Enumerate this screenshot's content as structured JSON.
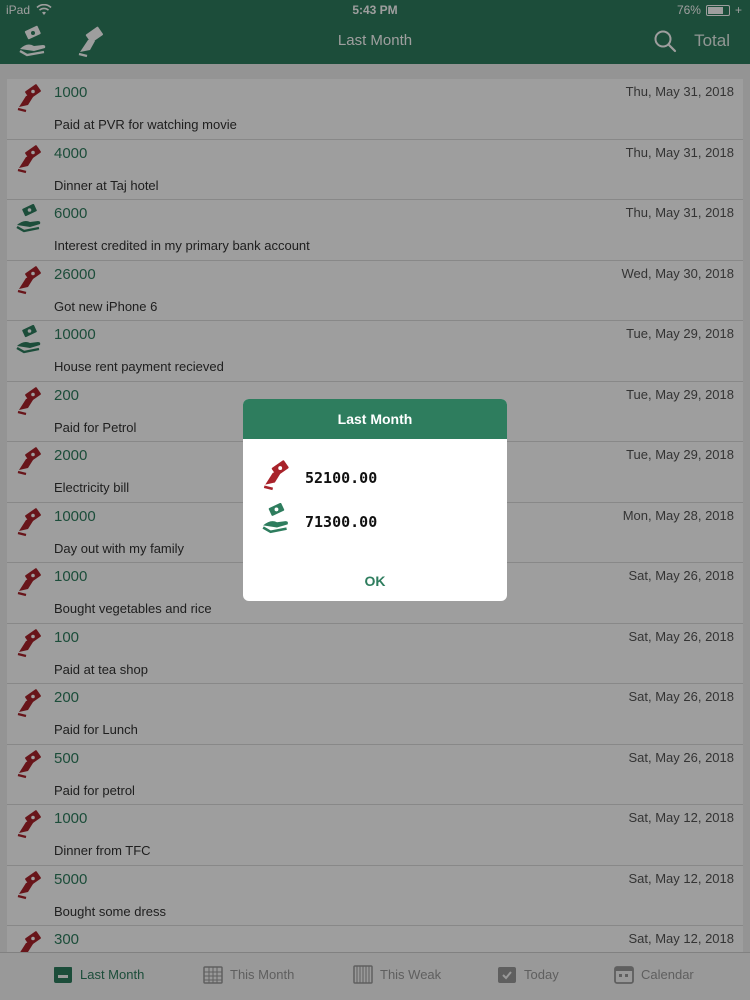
{
  "status": {
    "device": "iPad",
    "time": "5:43 PM",
    "battery_text": "76%",
    "battery_level": 0.76
  },
  "nav": {
    "title": "Last Month",
    "total_label": "Total"
  },
  "colors": {
    "brand": "#2e7d5e",
    "expense": "#a8222a",
    "income": "#2e7d5e"
  },
  "transactions": [
    {
      "type": "expense",
      "icon": "expense-hand-icon",
      "amount": "1000",
      "date": "Thu, May 31, 2018",
      "desc": "Paid at PVR for watching movie"
    },
    {
      "type": "expense",
      "icon": "expense-hand-icon",
      "amount": "4000",
      "date": "Thu, May 31, 2018",
      "desc": "Dinner at Taj hotel"
    },
    {
      "type": "income",
      "icon": "income-hand-icon",
      "amount": "6000",
      "date": "Thu, May 31, 2018",
      "desc": "Interest credited in my primary bank account"
    },
    {
      "type": "expense",
      "icon": "expense-hand-icon",
      "amount": "26000",
      "date": "Wed, May 30, 2018",
      "desc": "Got new iPhone 6"
    },
    {
      "type": "income",
      "icon": "income-hand-icon",
      "amount": "10000",
      "date": "Tue, May 29, 2018",
      "desc": "House rent payment recieved"
    },
    {
      "type": "expense",
      "icon": "expense-hand-icon",
      "amount": "200",
      "date": "Tue, May 29, 2018",
      "desc": "Paid for Petrol"
    },
    {
      "type": "expense",
      "icon": "expense-hand-icon",
      "amount": "2000",
      "date": "Tue, May 29, 2018",
      "desc": "Electricity bill"
    },
    {
      "type": "expense",
      "icon": "expense-hand-icon",
      "amount": "10000",
      "date": "Mon, May 28, 2018",
      "desc": "Day out with my family"
    },
    {
      "type": "expense",
      "icon": "expense-hand-icon",
      "amount": "1000",
      "date": "Sat, May 26, 2018",
      "desc": "Bought vegetables and rice"
    },
    {
      "type": "expense",
      "icon": "expense-hand-icon",
      "amount": "100",
      "date": "Sat, May 26, 2018",
      "desc": "Paid at tea shop"
    },
    {
      "type": "expense",
      "icon": "expense-hand-icon",
      "amount": "200",
      "date": "Sat, May 26, 2018",
      "desc": "Paid for Lunch"
    },
    {
      "type": "expense",
      "icon": "expense-hand-icon",
      "amount": "500",
      "date": "Sat, May 26, 2018",
      "desc": "Paid for petrol"
    },
    {
      "type": "expense",
      "icon": "expense-hand-icon",
      "amount": "1000",
      "date": "Sat, May 12, 2018",
      "desc": "Dinner from TFC"
    },
    {
      "type": "expense",
      "icon": "expense-hand-icon",
      "amount": "5000",
      "date": "Sat, May 12, 2018",
      "desc": "Bought some dress"
    },
    {
      "type": "expense",
      "icon": "expense-hand-icon",
      "amount": "300",
      "date": "Sat, May 12, 2018",
      "desc": ""
    }
  ],
  "tabs": [
    {
      "label": "Last Month",
      "icon": "calendar-month-icon",
      "active": true
    },
    {
      "label": "This Month",
      "icon": "calendar-grid-icon",
      "active": false
    },
    {
      "label": "This Weak",
      "icon": "calendar-week-icon",
      "active": false
    },
    {
      "label": "Today",
      "icon": "calendar-check-icon",
      "active": false
    },
    {
      "label": "Calendar",
      "icon": "calendar-icon",
      "active": false
    }
  ],
  "alert": {
    "title": "Last Month",
    "expense_total": "52100.00",
    "income_total": "71300.00",
    "ok_label": "OK"
  }
}
